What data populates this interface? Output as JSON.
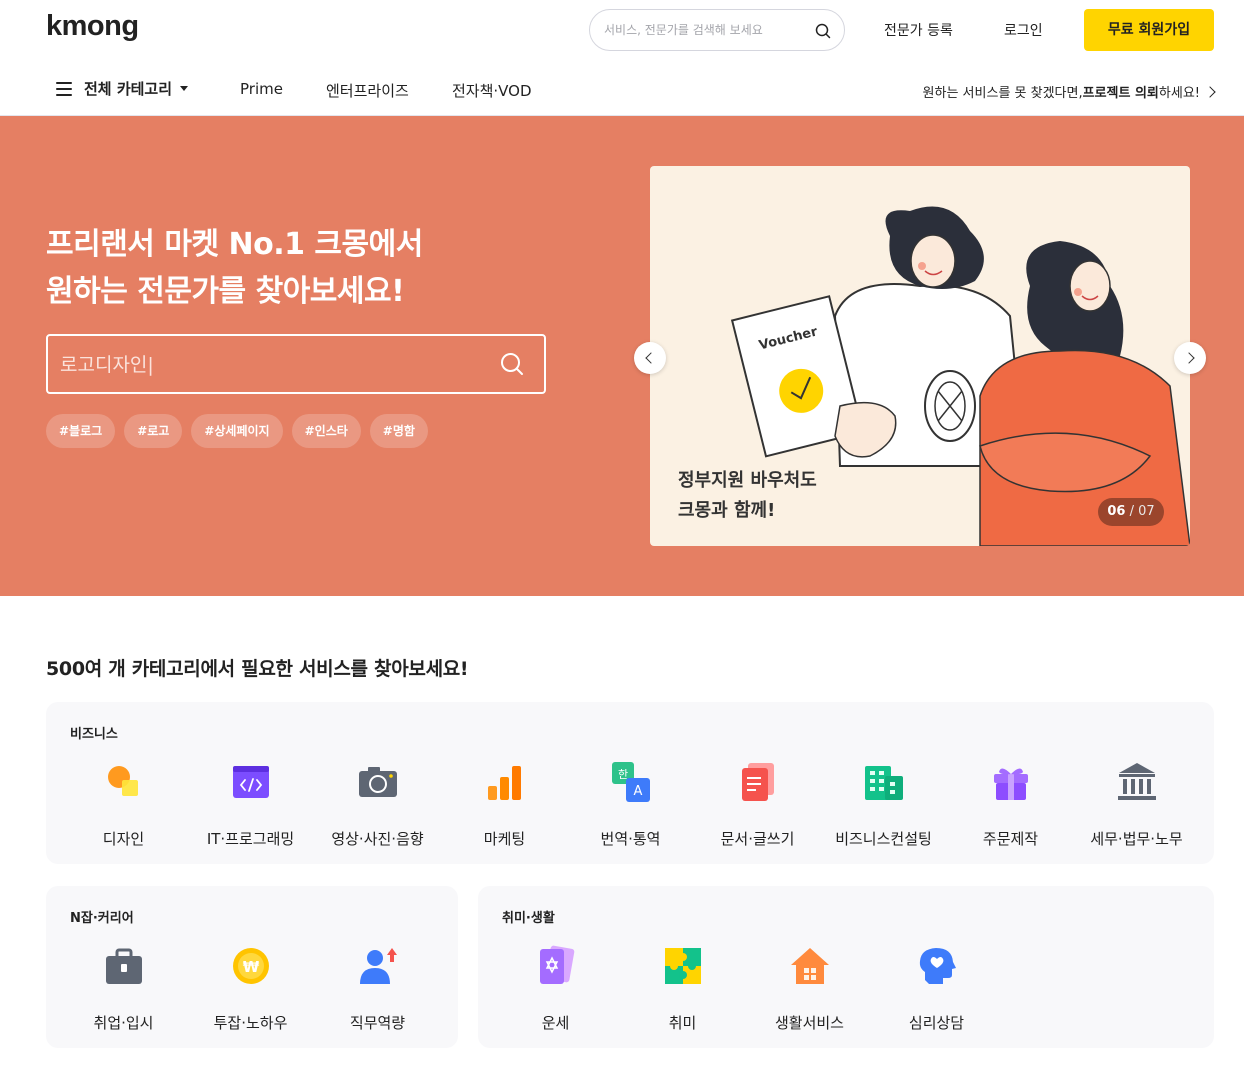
{
  "header": {
    "logo": "kmong",
    "search_placeholder": "서비스, 전문가를 검색해 보세요",
    "register_expert": "전문가 등록",
    "login": "로그인",
    "signup": "무료 회원가입",
    "all_categories": "전체 카테고리",
    "nav": [
      "Prime",
      "엔터프라이즈",
      "전자책·VOD"
    ],
    "cta_prefix": "원하는 서비스를 못 찾겠다면, ",
    "cta_bold": "프로젝트 의뢰",
    "cta_suffix": "하세요!"
  },
  "hero": {
    "title_line1": "프리랜서 마켓 No.1 크몽에서",
    "title_line2": "원하는 전문가를 찾아보세요!",
    "search_placeholder": "로고디자인|",
    "tags": [
      "#블로그",
      "#로고",
      "#상세페이지",
      "#인스타",
      "#명함"
    ],
    "banner": {
      "voucher_label": "Voucher",
      "text_line1": "정부지원 바우처도",
      "text_line2": "크몽과 함께!",
      "current": "06",
      "separator": " / ",
      "total": "07"
    }
  },
  "categories": {
    "heading": "500여 개 카테고리에서 필요한 서비스를 찾아보세요!",
    "business": {
      "title": "비즈니스",
      "items": [
        "디자인",
        "IT·프로그래밍",
        "영상·사진·음향",
        "마케팅",
        "번역·통역",
        "문서·글쓰기",
        "비즈니스컨설팅",
        "주문제작",
        "세무·법무·노무"
      ]
    },
    "career": {
      "title": "N잡·커리어",
      "items": [
        "취업·입시",
        "투잡·노하우",
        "직무역량"
      ]
    },
    "hobby": {
      "title": "취미·생활",
      "items": [
        "운세",
        "취미",
        "생활서비스",
        "심리상담"
      ]
    }
  },
  "colors": {
    "hero_bg": "#e57f63",
    "brand_yellow": "#ffd400",
    "panel_bg": "#f8f8fa"
  }
}
